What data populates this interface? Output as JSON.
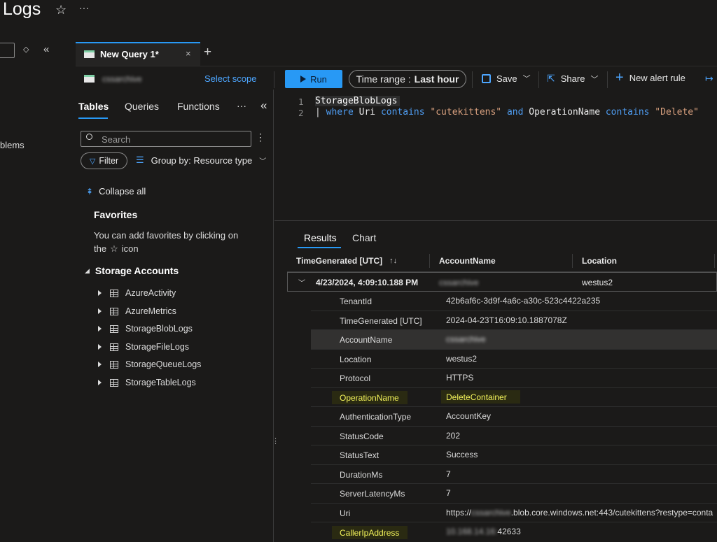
{
  "page": {
    "title": "Logs",
    "star_icon": "☆",
    "more_icon": "···"
  },
  "leftnav": {
    "partial_item": "blems"
  },
  "tabs": [
    {
      "label": "New Query 1*"
    }
  ],
  "scope": {
    "name": "cssarchive",
    "select_label": "Select scope"
  },
  "toolbar": {
    "run_label": "Run",
    "time_range_label": "Time range :",
    "time_range_value": "Last hour",
    "save_label": "Save",
    "share_label": "Share",
    "new_alert_label": "New alert rule"
  },
  "sidepanel": {
    "tabs": [
      "Tables",
      "Queries",
      "Functions"
    ],
    "search_placeholder": "Search",
    "filter_label": "Filter",
    "group_by_label": "Group by: Resource type",
    "collapse_all_label": "Collapse all",
    "favorites_heading": "Favorites",
    "favorites_text_1": "You can add favorites by clicking on",
    "favorites_text_2a": "the",
    "favorites_text_2b": "icon",
    "storage_heading": "Storage Accounts",
    "tables": [
      "AzureActivity",
      "AzureMetrics",
      "StorageBlobLogs",
      "StorageFileLogs",
      "StorageQueueLogs",
      "StorageTableLogs"
    ]
  },
  "editor": {
    "line_numbers": [
      "1",
      "2"
    ],
    "line1": "StorageBlobLogs",
    "line2": {
      "pipe": "| ",
      "kw_where": "where",
      "field_uri": " Uri ",
      "op_contains1": "contains",
      "str1": " \"cutekittens\" ",
      "kw_and": "and",
      "field_op": " OperationName ",
      "op_contains2": "contains",
      "str2": " \"Delete\""
    }
  },
  "results": {
    "tabs": [
      "Results",
      "Chart"
    ],
    "columns": [
      "TimeGenerated [UTC]",
      "AccountName",
      "Location"
    ],
    "sort_icon": "↑↓",
    "summary_row": {
      "time": "4/23/2024, 4:09:10.188 PM",
      "account": "cssarchive",
      "location": "westus2"
    },
    "details": [
      {
        "label": "TenantId",
        "value": "42b6af6c-3d9f-4a6c-a30c-523c4422a235"
      },
      {
        "label": "TimeGenerated [UTC]",
        "value": "2024-04-23T16:09:10.1887078Z"
      },
      {
        "label": "AccountName",
        "value": "cssarchive"
      },
      {
        "label": "Location",
        "value": "westus2"
      },
      {
        "label": "Protocol",
        "value": "HTTPS"
      },
      {
        "label": "OperationName",
        "value": "DeleteContainer"
      },
      {
        "label": "AuthenticationType",
        "value": "AccountKey"
      },
      {
        "label": "StatusCode",
        "value": "202"
      },
      {
        "label": "StatusText",
        "value": "Success"
      },
      {
        "label": "DurationMs",
        "value": "7"
      },
      {
        "label": "ServerLatencyMs",
        "value": "7"
      },
      {
        "label": "Uri",
        "value_prefix": "https://",
        "value_blur": "cssarchive",
        "value_suffix": ".blob.core.windows.net:443/cutekittens?restype=conta"
      },
      {
        "label": "CallerIpAddress",
        "value_blur": "10.168.14.16:",
        "value_suffix": "42633"
      }
    ]
  },
  "colors": {
    "background": "#1b1a19",
    "accent": "#2899f5",
    "highlight": "#f3f35a",
    "highlight_bg": "#2a2a12"
  }
}
